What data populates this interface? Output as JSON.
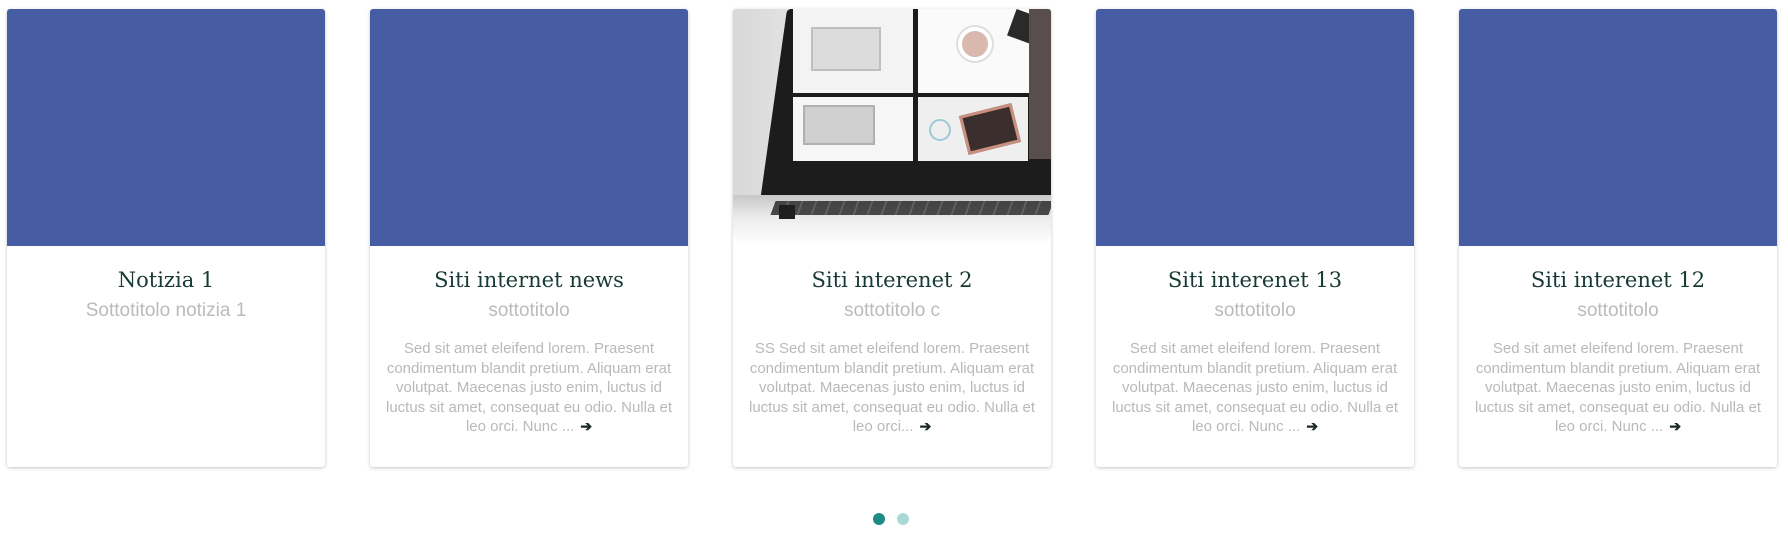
{
  "cards": [
    {
      "title": "Notizia 1",
      "subtitle": "Sottotitolo notizia 1",
      "text": "",
      "arrow": "",
      "image": "placeholder"
    },
    {
      "title": "Siti internet news",
      "subtitle": "sottotitolo",
      "text": "Sed sit amet eleifend lorem. Praesent condimentum blandit pretium. Aliquam erat volutpat. Maecenas justo enim, luctus id luctus sit amet, consequat eu odio. Nulla et leo orci. Nunc ...",
      "arrow": "➔",
      "image": "placeholder"
    },
    {
      "title": "Siti interenet 2",
      "subtitle": "sottotitolo c",
      "text": "SS Sed sit amet eleifend lorem. Praesent condimentum blandit pretium. Aliquam erat volutpat. Maecenas justo enim, luctus id luctus sit amet, consequat eu odio. Nulla et leo orci...",
      "arrow": "➔",
      "image": "laptop-desk-photo"
    },
    {
      "title": "Siti interenet 13",
      "subtitle": "sottotitolo",
      "text": "Sed sit amet eleifend lorem. Praesent condimentum blandit pretium. Aliquam erat volutpat. Maecenas justo enim, luctus id luctus sit amet, consequat eu odio. Nulla et leo orci. Nunc ...",
      "arrow": "➔",
      "image": "placeholder"
    },
    {
      "title": "Siti interenet 12",
      "subtitle": "sottotitolo",
      "text": "Sed sit amet eleifend lorem. Praesent condimentum blandit pretium. Aliquam erat volutpat. Maecenas justo enim, luctus id luctus sit amet, consequat eu odio. Nulla et leo orci. Nunc ...",
      "arrow": "➔",
      "image": "placeholder"
    }
  ],
  "pagination": {
    "pages": 2,
    "active_page": 1
  },
  "colors": {
    "placeholder_image": "#475da3",
    "title": "#173a35",
    "subtitle": "#bbbbbb",
    "body_text": "#b9b9b9",
    "dot_active": "#1e8c86",
    "dot_inactive": "#a9d9d6"
  }
}
